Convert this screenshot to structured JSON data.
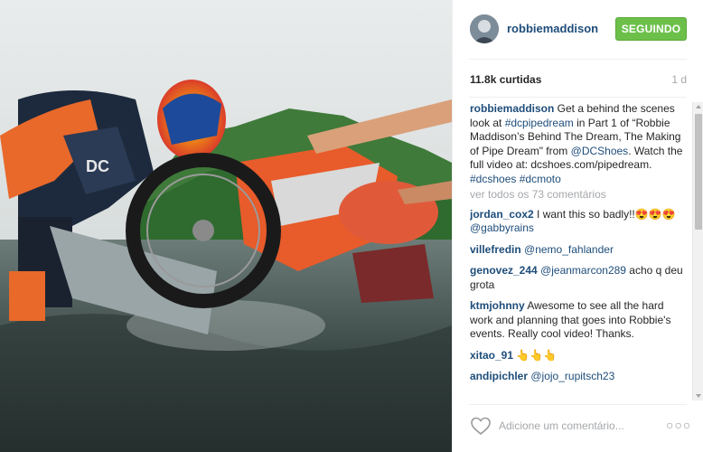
{
  "post": {
    "username": "robbiemaddison",
    "follow_label": "SEGUINDO",
    "likes": "11.8k curtidas",
    "time_ago": "1 d"
  },
  "caption": {
    "username": "robbiemaddison",
    "text_1": " Get a behind the scenes look at ",
    "hashtag_1": "#dcpipedream",
    "text_2": " in Part 1 of “Robbie Maddison’s Behind The Dream, The Making of Pipe Dream\" from ",
    "mention_1": "@DCShoes",
    "text_3": ". Watch the full video at: dcshoes.com/pipedream. ",
    "hashtag_2": "#dcshoes",
    "hashtag_3": "#dcmoto"
  },
  "view_all": "ver todos os 73 comentários",
  "comments": [
    {
      "user": "jordan_cox2",
      "text": " I want this so badly!!😍😍😍 ",
      "mention": "@gabbyrains",
      "text_after": ""
    },
    {
      "user": "villefredin",
      "text": " ",
      "mention": "@nemo_fahlander",
      "text_after": ""
    },
    {
      "user": "genovez_244",
      "text": " ",
      "mention": "@jeanmarcon289",
      "text_after": " acho q deu grota"
    },
    {
      "user": "ktmjohnny",
      "text": " Awesome to see all the hard work and planning that goes into Robbie's events. Really cool video! Thanks.",
      "mention": "",
      "text_after": ""
    },
    {
      "user": "xitao_91",
      "text": " 👆👆👆",
      "mention": "",
      "text_after": ""
    },
    {
      "user": "andipichler",
      "text": " ",
      "mention": "@jojo_rupitsch23",
      "text_after": ""
    }
  ],
  "footer": {
    "placeholder": "Adicione um comentário...",
    "more_label": "○○○"
  },
  "icons": {
    "like": "heart-icon",
    "more": "more-options-icon"
  },
  "colors": {
    "follow_button": "#6cc04a",
    "link": "#1e4d7a",
    "muted": "#a5a7aa"
  }
}
